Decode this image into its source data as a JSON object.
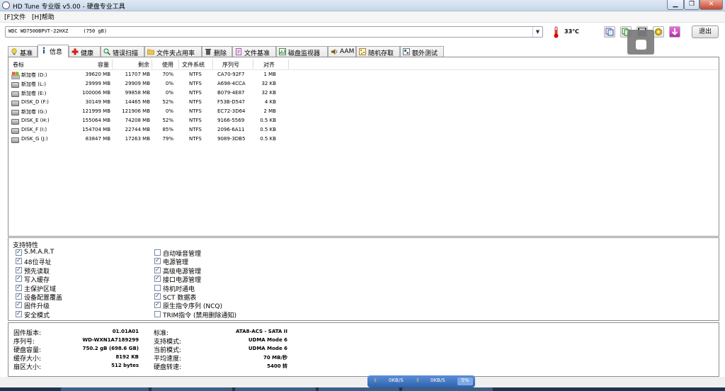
{
  "window": {
    "title": "HD Tune 专业版 v5.00 - 硬盘专业工具"
  },
  "menu": [
    "[F]文件",
    "[H]帮助"
  ],
  "drive": {
    "selected": "WDC WD7500BPVT-22HXZ     (750 gB)",
    "temperature": "33℃"
  },
  "toolbar": {
    "exit_label": "退出",
    "icons": [
      "copy-icon",
      "copy-text-icon",
      "save-icon",
      "settings-icon",
      "download-icon"
    ]
  },
  "tabs": [
    {
      "label": "基准",
      "icon": "bulb-icon"
    },
    {
      "label": "信息",
      "icon": "info-icon",
      "active": true
    },
    {
      "label": "健康",
      "icon": "plus-icon"
    },
    {
      "label": "错误扫描",
      "icon": "magnifier-icon"
    },
    {
      "label": "文件夹占用率",
      "icon": "folder-icon"
    },
    {
      "label": "删除",
      "icon": "trash-icon"
    },
    {
      "label": "文件基准",
      "icon": "file-icon"
    },
    {
      "label": "磁盘监视器",
      "icon": "monitor-icon"
    },
    {
      "label": "AAM",
      "icon": "speaker-icon"
    },
    {
      "label": "随机存取",
      "icon": "random-icon"
    },
    {
      "label": "额外测试",
      "icon": "extra-icon"
    }
  ],
  "volumes": {
    "headers": [
      "卷标",
      "容量",
      "剩余",
      "使用",
      "文件系统",
      "序列号",
      "对齐"
    ],
    "rows": [
      {
        "label": "新加卷 (D:)",
        "capacity": "39620 MB",
        "free": "11707 MB",
        "used": "70%",
        "fs": "NTFS",
        "serial": "CA70-92F7",
        "align": "1 MB"
      },
      {
        "label": "新加卷 (L:)",
        "capacity": "29999 MB",
        "free": "29909 MB",
        "used": "0%",
        "fs": "NTFS",
        "serial": "A698-4CCA",
        "align": "32 KB"
      },
      {
        "label": "新加卷 (E:)",
        "capacity": "100006 MB",
        "free": "99858 MB",
        "used": "0%",
        "fs": "NTFS",
        "serial": "B079-4E87",
        "align": "32 KB"
      },
      {
        "label": "DISK_D (F:)",
        "capacity": "30149 MB",
        "free": "14465 MB",
        "used": "52%",
        "fs": "NTFS",
        "serial": "F53B-D547",
        "align": "4 KB"
      },
      {
        "label": "新加卷 (G:)",
        "capacity": "121999 MB",
        "free": "121906 MB",
        "used": "0%",
        "fs": "NTFS",
        "serial": "EC72-3D64",
        "align": "2 MB"
      },
      {
        "label": "DISK_E (H:)",
        "capacity": "155064 MB",
        "free": "74208 MB",
        "used": "52%",
        "fs": "NTFS",
        "serial": "9166-5569",
        "align": "0.5 KB"
      },
      {
        "label": "DISK_F (I:)",
        "capacity": "154704 MB",
        "free": "22744 MB",
        "used": "85%",
        "fs": "NTFS",
        "serial": "2096-6A11",
        "align": "0.5 KB"
      },
      {
        "label": "DISK_G (J:)",
        "capacity": "83847 MB",
        "free": "17263 MB",
        "used": "79%",
        "fs": "NTFS",
        "serial": "9089-3DB5",
        "align": "0.5 KB"
      }
    ]
  },
  "features": {
    "title": "支持特性",
    "left": [
      {
        "label": "S.M.A.R.T",
        "checked": true
      },
      {
        "label": "48位寻址",
        "checked": true
      },
      {
        "label": "预先读取",
        "checked": true
      },
      {
        "label": "写入缓存",
        "checked": true
      },
      {
        "label": "主保护区域",
        "checked": true
      },
      {
        "label": "设备配置覆盖",
        "checked": true
      },
      {
        "label": "固件升级",
        "checked": true
      },
      {
        "label": "安全模式",
        "checked": true
      }
    ],
    "right": [
      {
        "label": "自动噪音管理",
        "checked": false
      },
      {
        "label": "电源管理",
        "checked": true
      },
      {
        "label": "高级电源管理",
        "checked": true
      },
      {
        "label": "接口电源管理",
        "checked": true
      },
      {
        "label": "待机时通电",
        "checked": false
      },
      {
        "label": "SCT 数据表",
        "checked": true
      },
      {
        "label": "原生指令序列 (NCQ)",
        "checked": true
      },
      {
        "label": "TRIM指令 (禁用删除通知)",
        "checked": false
      }
    ]
  },
  "info": {
    "left": [
      {
        "key": "固件版本:",
        "value": "01.01A01"
      },
      {
        "key": "序列号:",
        "value": "WD-WXN1A7189299"
      },
      {
        "key": "硬盘容量:",
        "value": "750.2 gB (698.6 GB)"
      },
      {
        "key": "缓存大小:",
        "value": "8192 KB"
      },
      {
        "key": "扇区大小:",
        "value": "512 bytes"
      }
    ],
    "right": [
      {
        "key": "标准:",
        "value": "ATA8-ACS - SATA II"
      },
      {
        "key": "支持模式:",
        "value": "UDMA Mode 6"
      },
      {
        "key": "当前模式:",
        "value": "UDMA Mode 6"
      },
      {
        "key": "平均速度:",
        "value": "70 MB/秒"
      },
      {
        "key": "硬盘转速:",
        "value": "5400 转"
      }
    ]
  },
  "status": {
    "down": "0KB/S",
    "up": "0KB/S",
    "percent": "5%"
  }
}
